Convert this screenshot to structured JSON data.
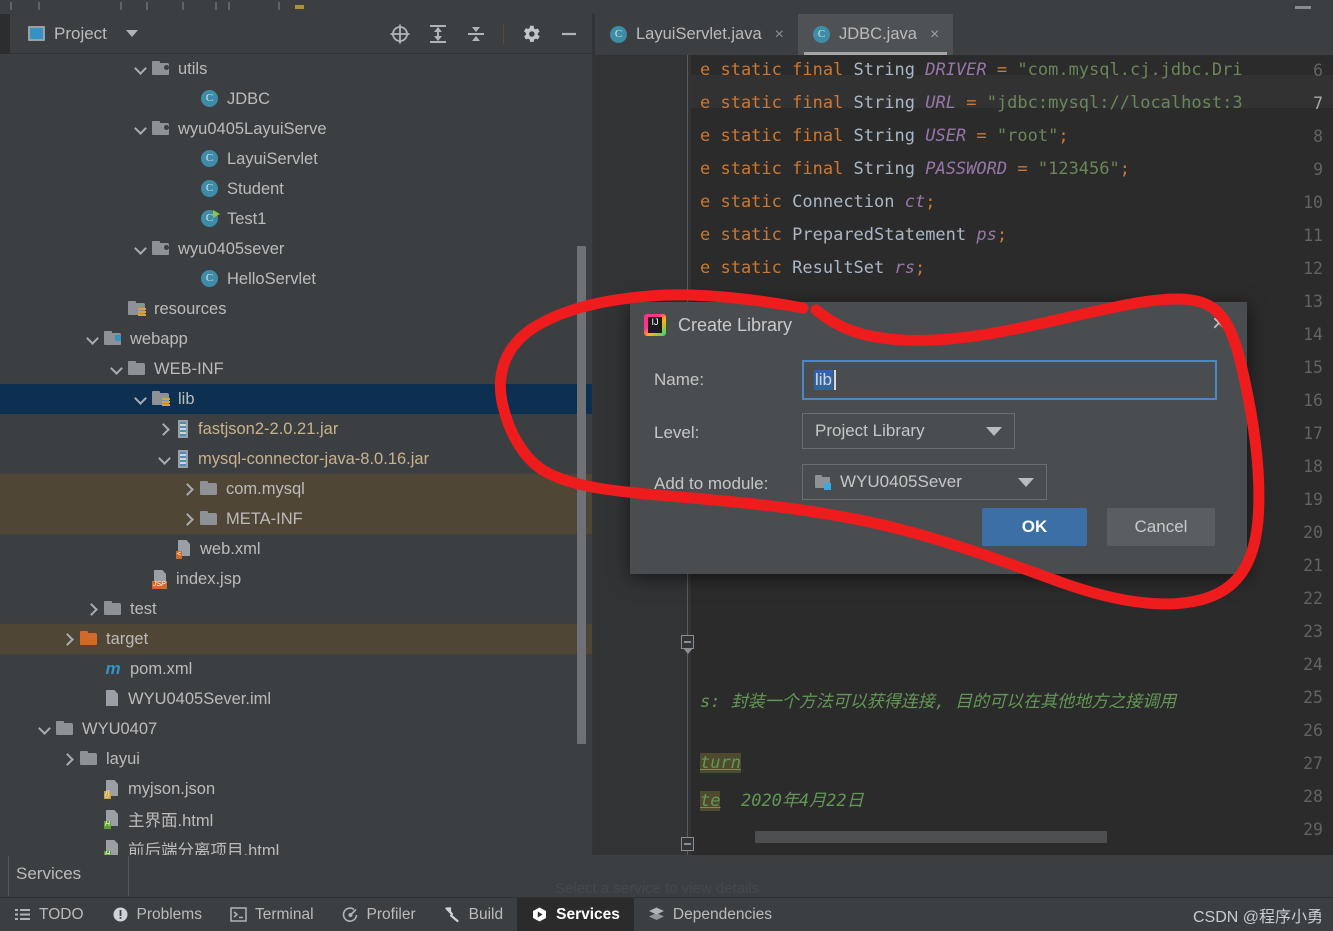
{
  "app": {
    "theme_bg": "#3c3f41",
    "editor_bg": "#2b2b2b",
    "accent": "#3c6fa5",
    "selection_blue": "#0d3050",
    "marker_color": "#ee1c1c"
  },
  "project_panel": {
    "title": "Project",
    "title_icon": "project-window-icon",
    "header_buttons": [
      {
        "name": "scroll-from-source-icon",
        "label": "Select Opened File"
      },
      {
        "name": "expand-all-icon",
        "label": "Expand All"
      },
      {
        "name": "collapse-all-icon",
        "label": "Collapse All"
      },
      {
        "name": "gear-icon",
        "label": "Options"
      },
      {
        "name": "minimize-icon",
        "label": "Hide"
      }
    ],
    "tree": [
      {
        "label": "utils",
        "indent": 5,
        "arrow": "down",
        "icon": "folder-source",
        "state": "normal"
      },
      {
        "label": "JDBC",
        "indent": 7,
        "arrow": "none",
        "icon": "java-class",
        "state": "normal"
      },
      {
        "label": "wyu0405LayuiServe",
        "indent": 5,
        "arrow": "down",
        "icon": "folder-source",
        "state": "normal"
      },
      {
        "label": "LayuiServlet",
        "indent": 7,
        "arrow": "none",
        "icon": "java-class",
        "state": "normal"
      },
      {
        "label": "Student",
        "indent": 7,
        "arrow": "none",
        "icon": "java-class",
        "state": "normal"
      },
      {
        "label": "Test1",
        "indent": 7,
        "arrow": "none",
        "icon": "java-class-runnable",
        "state": "normal"
      },
      {
        "label": "wyu0405sever",
        "indent": 5,
        "arrow": "down",
        "icon": "folder-source",
        "state": "normal"
      },
      {
        "label": "HelloServlet",
        "indent": 7,
        "arrow": "none",
        "icon": "java-class",
        "state": "normal"
      },
      {
        "label": "resources",
        "indent": 4,
        "arrow": "none",
        "icon": "folder-resources",
        "state": "normal"
      },
      {
        "label": "webapp",
        "indent": 3,
        "arrow": "down",
        "icon": "folder-web",
        "state": "normal"
      },
      {
        "label": "WEB-INF",
        "indent": 4,
        "arrow": "down",
        "icon": "folder",
        "state": "normal"
      },
      {
        "label": "lib",
        "indent": 5,
        "arrow": "down",
        "icon": "folder-resources",
        "state": "selected"
      },
      {
        "label": "fastjson2-2.0.21.jar",
        "indent": 6,
        "arrow": "right",
        "icon": "jar",
        "state": "normal"
      },
      {
        "label": "mysql-connector-java-8.0.16.jar",
        "indent": 6,
        "arrow": "down",
        "icon": "jar",
        "state": "normal"
      },
      {
        "label": "com.mysql",
        "indent": 7,
        "arrow": "right",
        "icon": "folder",
        "state": "highlight"
      },
      {
        "label": "META-INF",
        "indent": 7,
        "arrow": "right",
        "icon": "folder",
        "state": "highlight"
      },
      {
        "label": "web.xml",
        "indent": 6,
        "arrow": "none",
        "icon": "file-xml",
        "state": "normal"
      },
      {
        "label": "index.jsp",
        "indent": 5,
        "arrow": "none",
        "icon": "file-jsp",
        "state": "normal"
      },
      {
        "label": "test",
        "indent": 3,
        "arrow": "right",
        "icon": "folder",
        "state": "normal"
      },
      {
        "label": "target",
        "indent": 2,
        "arrow": "right",
        "icon": "folder-excluded",
        "state": "highlight"
      },
      {
        "label": "pom.xml",
        "indent": 3,
        "arrow": "none",
        "icon": "maven",
        "state": "normal"
      },
      {
        "label": "WYU0405Sever.iml",
        "indent": 3,
        "arrow": "none",
        "icon": "file-iml",
        "state": "normal"
      },
      {
        "label": "WYU0407",
        "indent": 1,
        "arrow": "down",
        "icon": "folder",
        "state": "normal"
      },
      {
        "label": "layui",
        "indent": 2,
        "arrow": "right",
        "icon": "folder",
        "state": "normal"
      },
      {
        "label": "myjson.json",
        "indent": 3,
        "arrow": "none",
        "icon": "file-json",
        "state": "normal"
      },
      {
        "label": "主界面.html",
        "indent": 3,
        "arrow": "none",
        "icon": "file-html",
        "state": "normal"
      },
      {
        "label": "前后端分离项目.html",
        "indent": 3,
        "arrow": "none",
        "icon": "file-html",
        "state": "normal"
      }
    ]
  },
  "editor": {
    "tabs": [
      {
        "label": "LayuiServlet.java",
        "icon": "java-class",
        "active": false,
        "close": "×"
      },
      {
        "label": "JDBC.java",
        "icon": "java-class",
        "active": true,
        "close": "×"
      }
    ],
    "line_numbers": [
      "6",
      "7",
      "8",
      "9",
      "10",
      "11",
      "12",
      "13",
      "14",
      "15",
      "16",
      "17",
      "18",
      "19",
      "20",
      "21",
      "22",
      "23",
      "24",
      "25",
      "26",
      "27",
      "28",
      "29"
    ],
    "lines": [
      {
        "n": "6",
        "html": "<span class=\"k\">e static final</span> <span class=\"t\">String</span> <span class=\"f\">DRIVER</span> <span class=\"k\">=</span> <span class=\"s\">\"com.mysql.cj.jdbc.Dri</span>"
      },
      {
        "n": "7",
        "html": "<span class=\"k\">e static final</span> <span class=\"t\">String</span> <span class=\"f\">URL</span> <span class=\"k\">=</span> <span class=\"s\">\"jdbc:mysql://localhost:3</span>"
      },
      {
        "n": "8",
        "html": "<span class=\"k\">e static final</span> <span class=\"t\">String</span> <span class=\"f\">USER</span> <span class=\"k\">=</span> <span class=\"s\">\"root\"</span><span class=\"k\">;</span>"
      },
      {
        "n": "9",
        "html": "<span class=\"k\">e static final</span> <span class=\"t\">String</span> <span class=\"f\">PASSWORD</span> <span class=\"k\">=</span> <span class=\"s\">\"123456\"</span><span class=\"k\">;</span>"
      },
      {
        "n": "10",
        "html": "<span class=\"k\">e static</span> <span class=\"t\">Connection</span> <span class=\"f\">ct</span><span class=\"k\">;</span>"
      },
      {
        "n": "11",
        "html": "<span class=\"k\">e static</span> <span class=\"t\">PreparedStatement</span> <span class=\"f\">ps</span><span class=\"k\">;</span>"
      },
      {
        "n": "12",
        "html": "<span class=\"k\">e static</span> <span class=\"t\">ResultSet</span> <span class=\"f\">rs</span><span class=\"k\">;</span>"
      },
      {
        "n": "25",
        "html": "<span class=\"cm\">s: 封装一个方法可以获得连接, 目的可以在其他地方之接调用</span>"
      },
      {
        "n": "27",
        "html": "<span class=\"tg\">turn</span>"
      },
      {
        "n": "28",
        "html": "<span class=\"tg\">te</span> <span class=\"cm\"> 2020年4月22日</span>"
      }
    ]
  },
  "dialog": {
    "title": "Create Library",
    "title_icon": "intellij-idea-icon",
    "close_label": "×",
    "name_label": "Name:",
    "name_value": "lib",
    "level_label": "Level:",
    "level_value": "Project Library",
    "module_label": "Add to module:",
    "module_value": "WYU0405Sever",
    "module_icon": "module-folder-icon",
    "ok_label": "OK",
    "cancel_label": "Cancel"
  },
  "bottom": {
    "services_panel_title": "Services",
    "faint_text": "Select a service to view details",
    "toolbar": [
      {
        "label": "TODO",
        "icon": "todo-icon",
        "active": false
      },
      {
        "label": "Problems",
        "icon": "problems-icon",
        "active": false
      },
      {
        "label": "Terminal",
        "icon": "terminal-icon",
        "active": false
      },
      {
        "label": "Profiler",
        "icon": "profiler-icon",
        "active": false
      },
      {
        "label": "Build",
        "icon": "build-hammer-icon",
        "active": false
      },
      {
        "label": "Services",
        "icon": "services-icon",
        "active": true
      },
      {
        "label": "Dependencies",
        "icon": "dependencies-icon",
        "active": false
      }
    ],
    "watermark": "CSDN @程序小勇"
  }
}
